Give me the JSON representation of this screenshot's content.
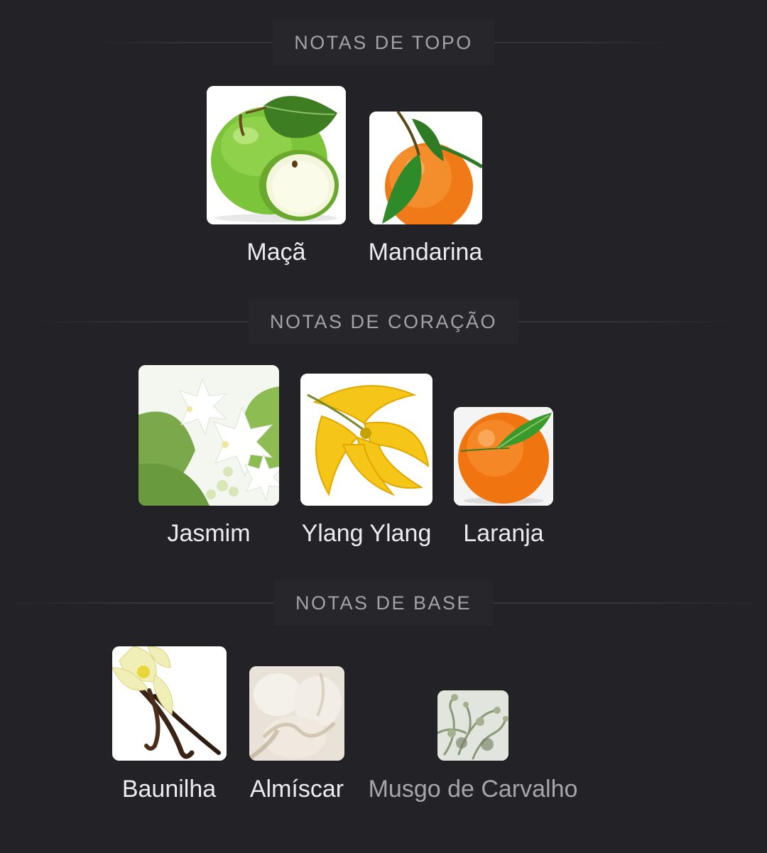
{
  "sections": [
    {
      "title": "NOTAS DE TOPO",
      "notes": [
        {
          "label": "Maçã",
          "icon": "green-apple-icon"
        },
        {
          "label": "Mandarina",
          "icon": "mandarin-icon"
        }
      ]
    },
    {
      "title": "NOTAS DE CORAÇÃO",
      "notes": [
        {
          "label": "Jasmim",
          "icon": "jasmine-icon"
        },
        {
          "label": "Ylang Ylang",
          "icon": "ylang-ylang-icon"
        },
        {
          "label": "Laranja",
          "icon": "orange-icon"
        }
      ]
    },
    {
      "title": "NOTAS DE BASE",
      "notes": [
        {
          "label": "Baunilha",
          "icon": "vanilla-icon"
        },
        {
          "label": "Almíscar",
          "icon": "musk-icon"
        },
        {
          "label": "Musgo de Carvalho",
          "icon": "oakmoss-icon"
        }
      ]
    }
  ],
  "colors": {
    "background": "#232226",
    "section_title": "#a3a3a7",
    "note_label": "#ececee"
  }
}
